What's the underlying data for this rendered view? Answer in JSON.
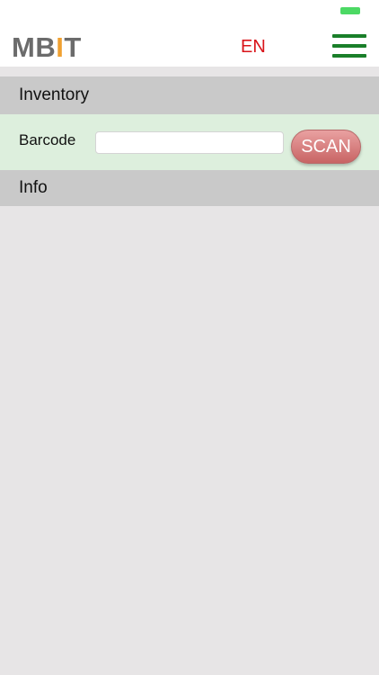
{
  "app": {
    "logo": {
      "prefix": "MB",
      "accent": "I",
      "suffix": "T"
    },
    "language": "EN",
    "menu_icon": "hamburger-menu-icon"
  },
  "sections": {
    "inventory": "Inventory",
    "info": "Info"
  },
  "barcode": {
    "label": "Barcode",
    "value": "",
    "placeholder": "",
    "scan_label": "SCAN"
  },
  "colors": {
    "language_text": "#d9141a",
    "menu_icon": "#1a7f2a",
    "logo_accent": "#f0a030",
    "barcode_row_bg": "#ddefdd",
    "scan_button": "#d47f7f",
    "battery": "#4cd964"
  }
}
